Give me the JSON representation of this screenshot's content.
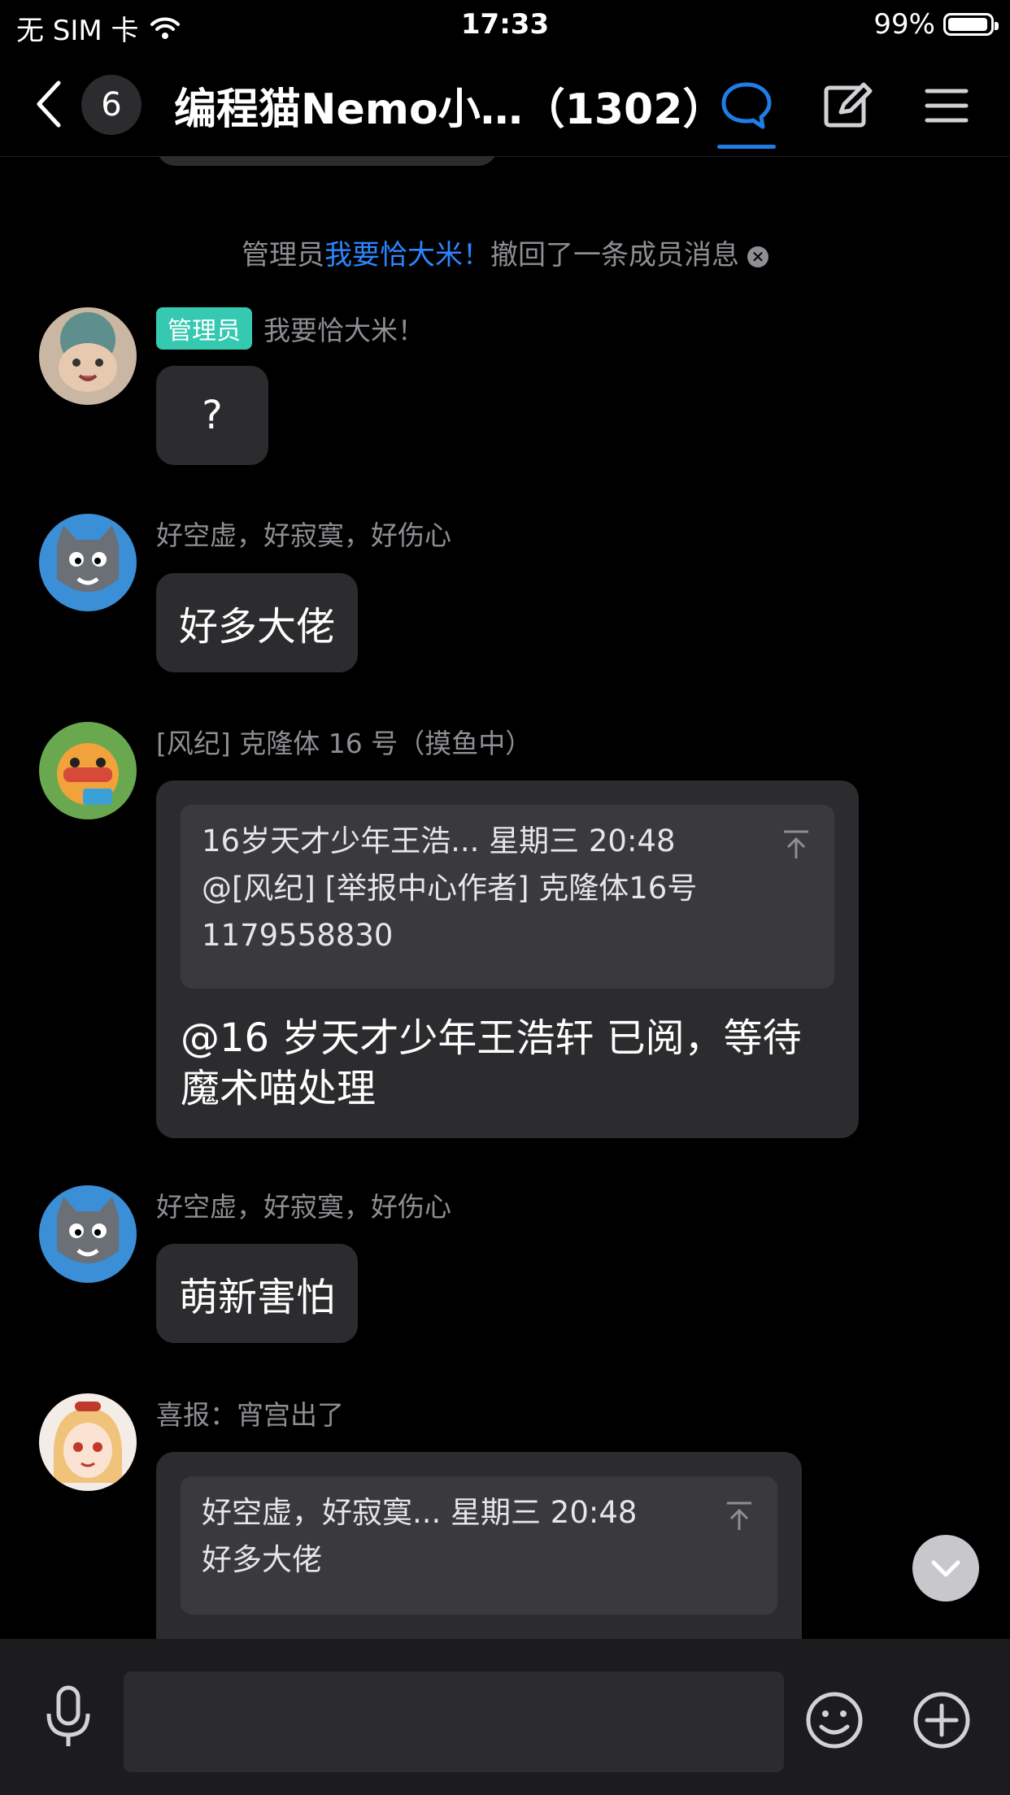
{
  "status_bar": {
    "carrier": "无 SIM 卡",
    "time": "17:33",
    "battery": "99%",
    "battery_level": 0.99
  },
  "nav": {
    "unread_count": "6",
    "title": "编程猫Nemo小…（1302）"
  },
  "system_message": {
    "prefix": "管理员",
    "name": "我要恰大米！",
    "suffix": "撤回了一条成员消息"
  },
  "messages": [
    {
      "role_badge": "管理员",
      "sender": "我要恰大米！",
      "text": "?"
    },
    {
      "sender": "好空虚，好寂寞，好伤心",
      "text": "好多大佬"
    },
    {
      "sender": "[风纪] 克隆体 16 号（摸鱼中）",
      "quote_line1": "16岁天才少年王浩... 星期三 20:48",
      "quote_line2": "@[风纪] [举报中心作者] 克隆体16号",
      "quote_line3": "1179558830",
      "text_line1": "@16 岁天才少年王浩轩 已阅，等待",
      "text_line2": "魔术喵处理"
    },
    {
      "sender": "好空虚，好寂寞，好伤心",
      "text": "萌新害怕"
    },
    {
      "sender": "喜报：宵宫出了",
      "quote_line1": "好空虚，好寂寞... 星期三 20:48",
      "quote_line2": "好多大佬"
    }
  ],
  "input": {
    "placeholder": ""
  },
  "colors": {
    "accent": "#1f7de6",
    "admin_badge": "#34c9b0",
    "bubble": "#2c2c2e",
    "background": "#000000"
  },
  "icons": [
    "back-chevron-icon",
    "chat-bubble-icon",
    "edit-icon",
    "menu-icon",
    "arrow-to-top-icon",
    "chevron-down-icon",
    "microphone-icon",
    "emoji-icon",
    "plus-icon",
    "wifi-icon",
    "battery-icon"
  ]
}
